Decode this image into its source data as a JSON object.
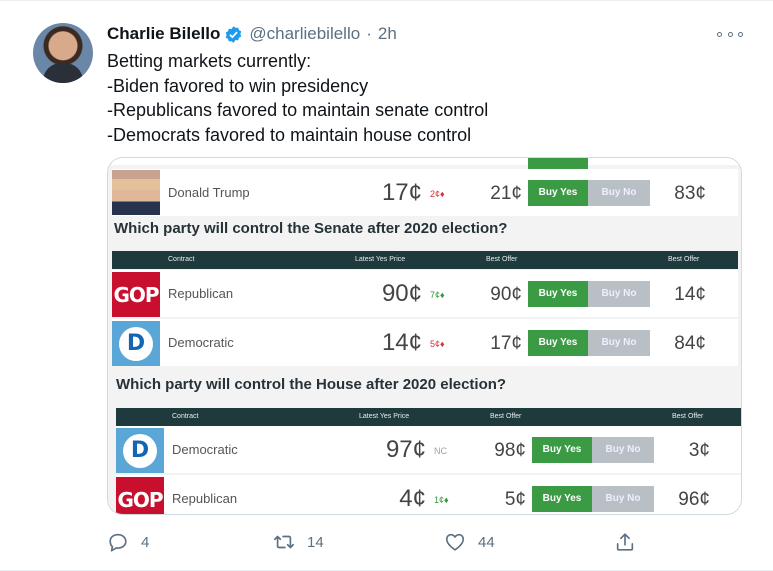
{
  "tweet": {
    "name": "Charlie Bilello",
    "handle": "@charliebilello",
    "dot": "·",
    "time": "2h",
    "lines": [
      "Betting markets currently:",
      "-Biden favored to win presidency",
      "-Republicans favored to maintain senate control",
      "-Democrats favored to maintain house control"
    ]
  },
  "media": {
    "top_row": {
      "name": "Donald Trump",
      "price": "17¢",
      "change": "2¢♦",
      "offer1": "21¢",
      "buy": "Buy Yes",
      "sell": "Buy No",
      "offer2": "83¢"
    },
    "senate": {
      "question": "Which party will control the Senate after 2020 election?",
      "headers": {
        "contract": "Contract",
        "latest": "Latest Yes Price",
        "best1": "Best Offer",
        "best2": "Best Offer"
      },
      "rows": [
        {
          "logo": "GOP",
          "name": "Republican",
          "price": "90¢",
          "change": "7¢♦",
          "offer1": "90¢",
          "buy": "Buy Yes",
          "sell": "Buy No",
          "offer2": "14¢"
        },
        {
          "logo": "D",
          "name": "Democratic",
          "price": "14¢",
          "change": "5¢♦",
          "offer1": "17¢",
          "buy": "Buy Yes",
          "sell": "Buy No",
          "offer2": "84¢"
        }
      ]
    },
    "house": {
      "question": "Which party will control the House after 2020 election?",
      "headers": {
        "contract": "Contract",
        "latest": "Latest Yes Price",
        "best1": "Best Offer",
        "best2": "Best Offer"
      },
      "rows": [
        {
          "logo": "D",
          "name": "Democratic",
          "price": "97¢",
          "change": "NC",
          "offer1": "98¢",
          "buy": "Buy Yes",
          "sell": "Buy No",
          "offer2": "3¢"
        },
        {
          "logo": "GOP",
          "name": "Republican",
          "price": "4¢",
          "change": "1¢♦",
          "offer1": "5¢",
          "buy": "Buy Yes",
          "sell": "Buy No",
          "offer2": "96¢"
        }
      ]
    }
  },
  "actions": {
    "replies": "4",
    "retweets": "14",
    "likes": "44"
  },
  "icons": [
    "verified-badge-icon",
    "more-icon",
    "reply-icon",
    "retweet-icon",
    "like-icon",
    "share-icon"
  ],
  "colors": {
    "verified": "#1d9bf0",
    "buy_green": "#3b9b45",
    "header_dark": "#1f3a3d",
    "gop_red": "#c8102e",
    "dem_blue": "#5aa6d6"
  }
}
